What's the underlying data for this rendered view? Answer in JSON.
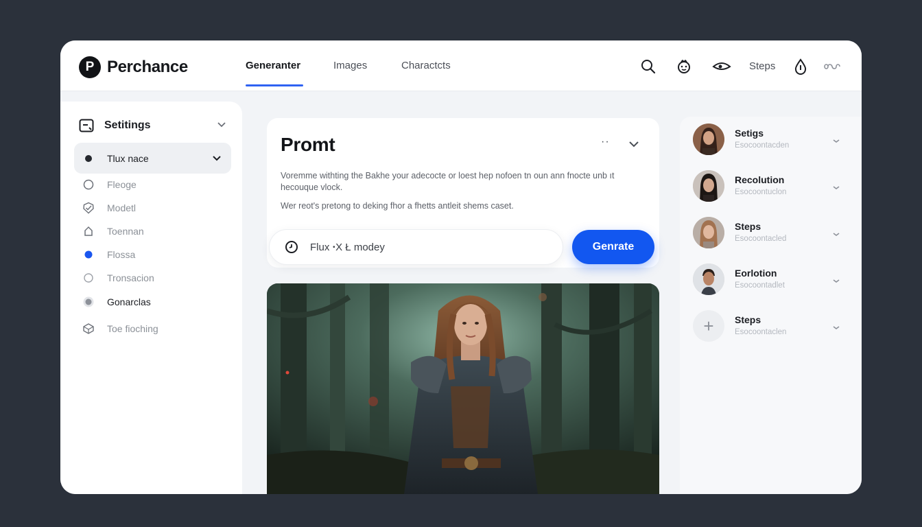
{
  "app": {
    "name": "Perchance",
    "logo_letter": "P"
  },
  "nav": {
    "tabs": [
      {
        "label": "Generanter"
      },
      {
        "label": "Images"
      },
      {
        "label": "Charactcts"
      }
    ],
    "active_index": 0,
    "steps_label": "Steps"
  },
  "header_icons": [
    "search-icon",
    "face-icon",
    "eye-icon",
    "drop-icon",
    "infinity-icon"
  ],
  "sidebar": {
    "title": "Setitings",
    "selected": {
      "label": "Tlux nace"
    },
    "items": [
      {
        "label": "Fleoge",
        "icon": "circle-outline-icon"
      },
      {
        "label": "Modetl",
        "icon": "badge-check-icon"
      },
      {
        "label": "Toennan",
        "icon": "home-outline-icon"
      },
      {
        "label": "Flossa",
        "icon": "blue-dot-icon"
      },
      {
        "label": "Tronsacion",
        "icon": "small-circle-icon"
      },
      {
        "label": "Gonarclas",
        "icon": "radio-filled-icon"
      },
      {
        "label": "Toe fioching",
        "icon": "cube-icon"
      }
    ]
  },
  "prompt": {
    "title": "Promt",
    "more": "··",
    "description": "Voremme withting the Bakhe your adecocte or loest hep nofoen tn oun ann fnocte unb ıt hecouque vlock.",
    "description2": "Wer reot's pretong to deking fhor a fhetts antleit shems caset.",
    "model_value": "Flux ꞏX Ł modey",
    "generate_label": "Genrate"
  },
  "right_panel": {
    "items": [
      {
        "title": "Setigs",
        "subtitle": "Esocoontacden"
      },
      {
        "title": "Recolution",
        "subtitle": "Esocoontuclon"
      },
      {
        "title": "Steps",
        "subtitle": "Esocoontacled"
      },
      {
        "title": "Eorlotion",
        "subtitle": "Esocoontadlet"
      },
      {
        "title": "Steps",
        "subtitle": "Esocoontaclen"
      }
    ],
    "add_symbol": "+"
  },
  "colors": {
    "accent": "#1257f0",
    "tab_underline": "#2f62f2",
    "background": "#2b313b"
  }
}
